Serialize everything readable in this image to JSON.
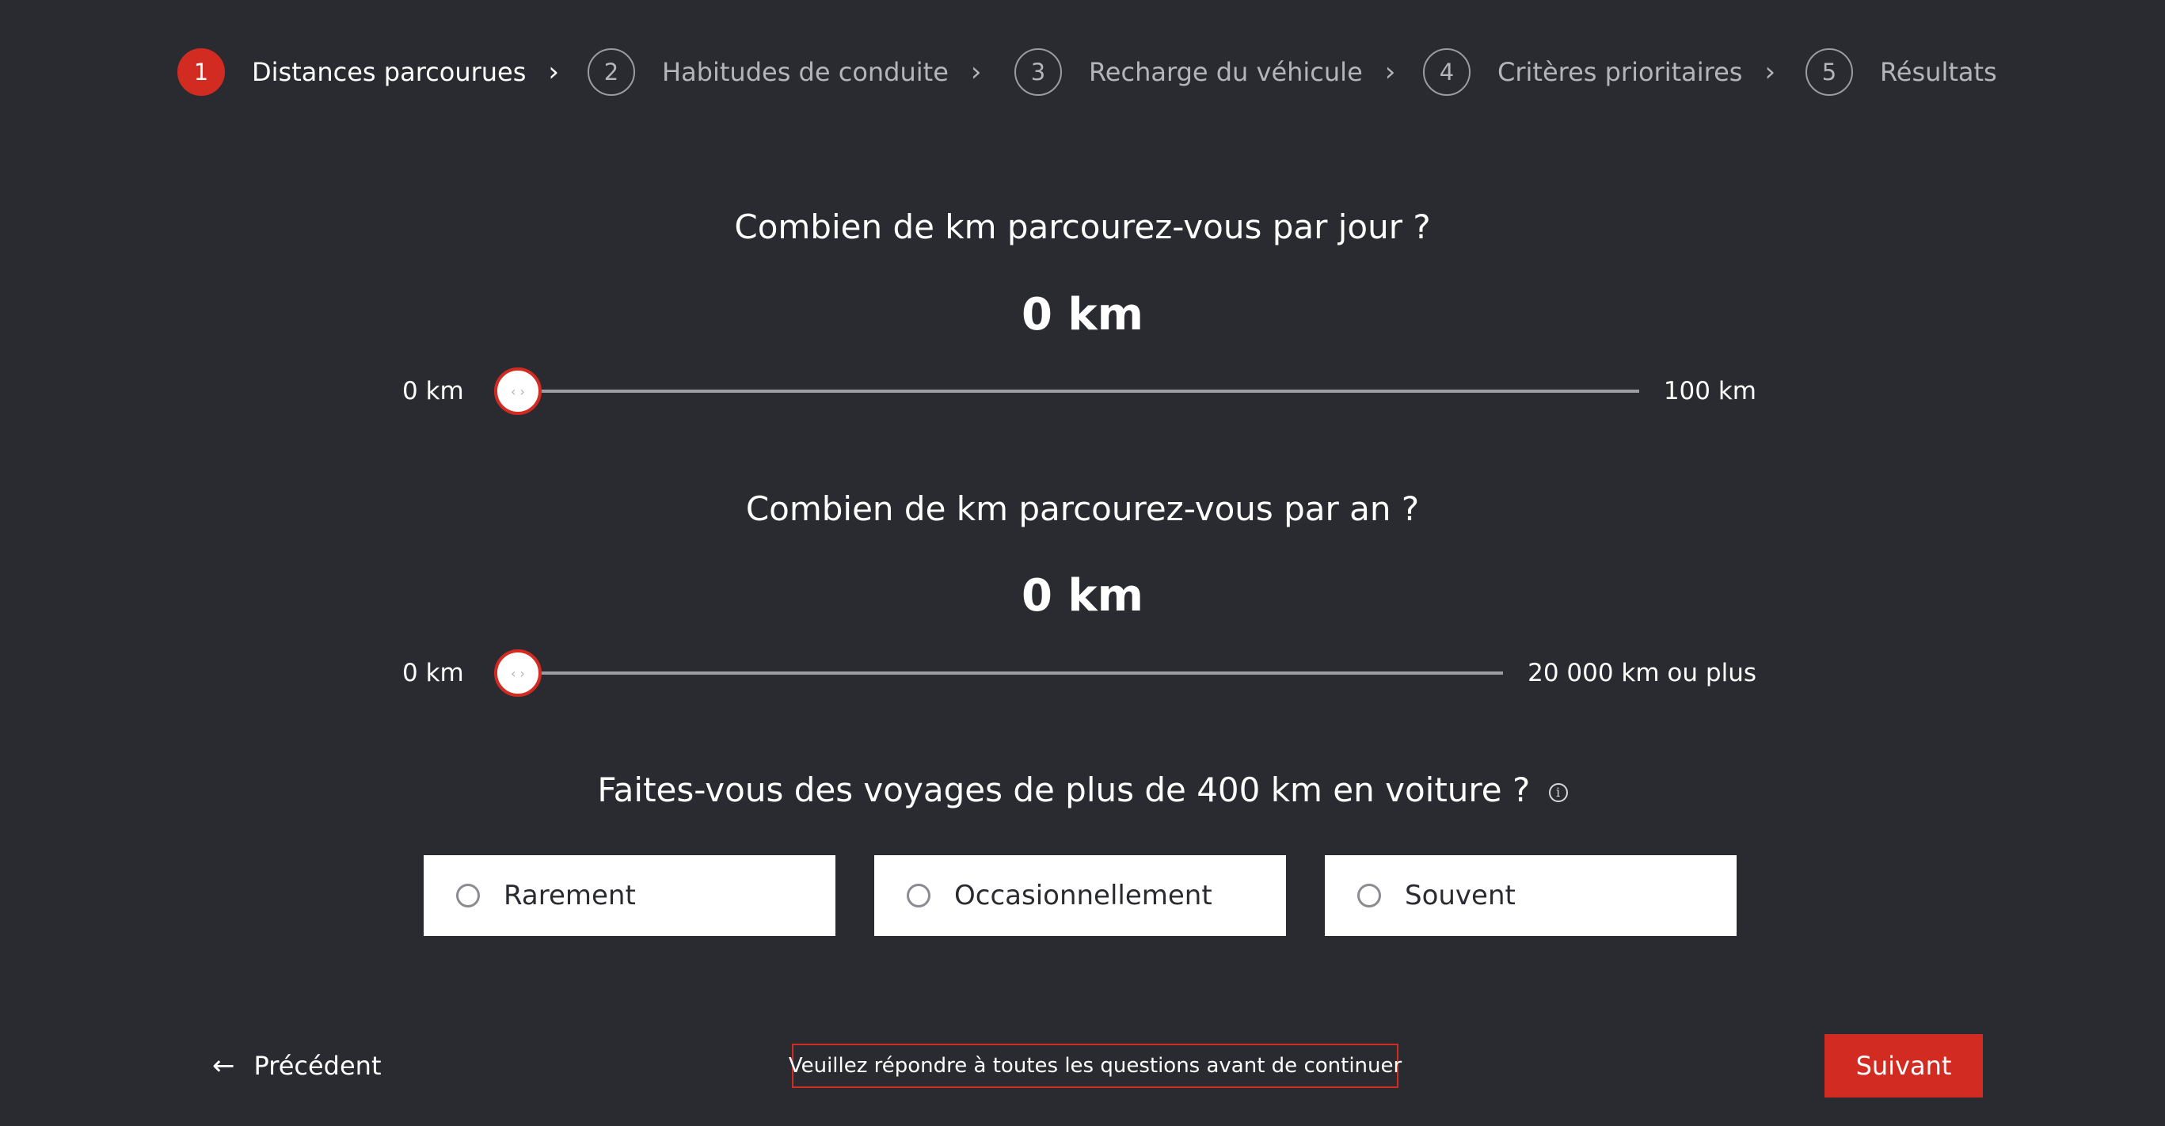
{
  "stepper": {
    "steps": [
      {
        "number": "1",
        "label": "Distances parcourues",
        "active": true
      },
      {
        "number": "2",
        "label": "Habitudes de conduite",
        "active": false
      },
      {
        "number": "3",
        "label": "Recharge du véhicule",
        "active": false
      },
      {
        "number": "4",
        "label": "Critères prioritaires",
        "active": false
      },
      {
        "number": "5",
        "label": "Résultats",
        "active": false
      }
    ],
    "chevron": "›"
  },
  "daily": {
    "question": "Combien de km parcourez-vous par jour ?",
    "value": "0 km",
    "min_label": "0 km",
    "max_label": "100 km",
    "fraction": 0
  },
  "yearly": {
    "question": "Combien de km parcourez-vous par an ?",
    "value": "0 km",
    "min_label": "0 km",
    "max_label": "20 000 km ou plus",
    "fraction": 0
  },
  "trips": {
    "question": "Faites-vous des voyages de plus de 400 km en voiture ?",
    "info_icon": "i",
    "options": [
      "Rarement",
      "Occasionnellement",
      "Souvent"
    ]
  },
  "footer": {
    "prev_arrow": "←",
    "prev_label": "Précédent",
    "warning": "Veuillez répondre à toutes les questions avant de continuer",
    "next_label": "Suivant"
  },
  "colors": {
    "background": "#2a2b30",
    "accent": "#d22b22",
    "muted": "#b4b5ba"
  },
  "icons": {
    "slider_thumb": "arrows-left-right-icon",
    "info": "info-icon",
    "prev": "arrow-left-icon",
    "step_separator": "chevron-right-icon"
  }
}
